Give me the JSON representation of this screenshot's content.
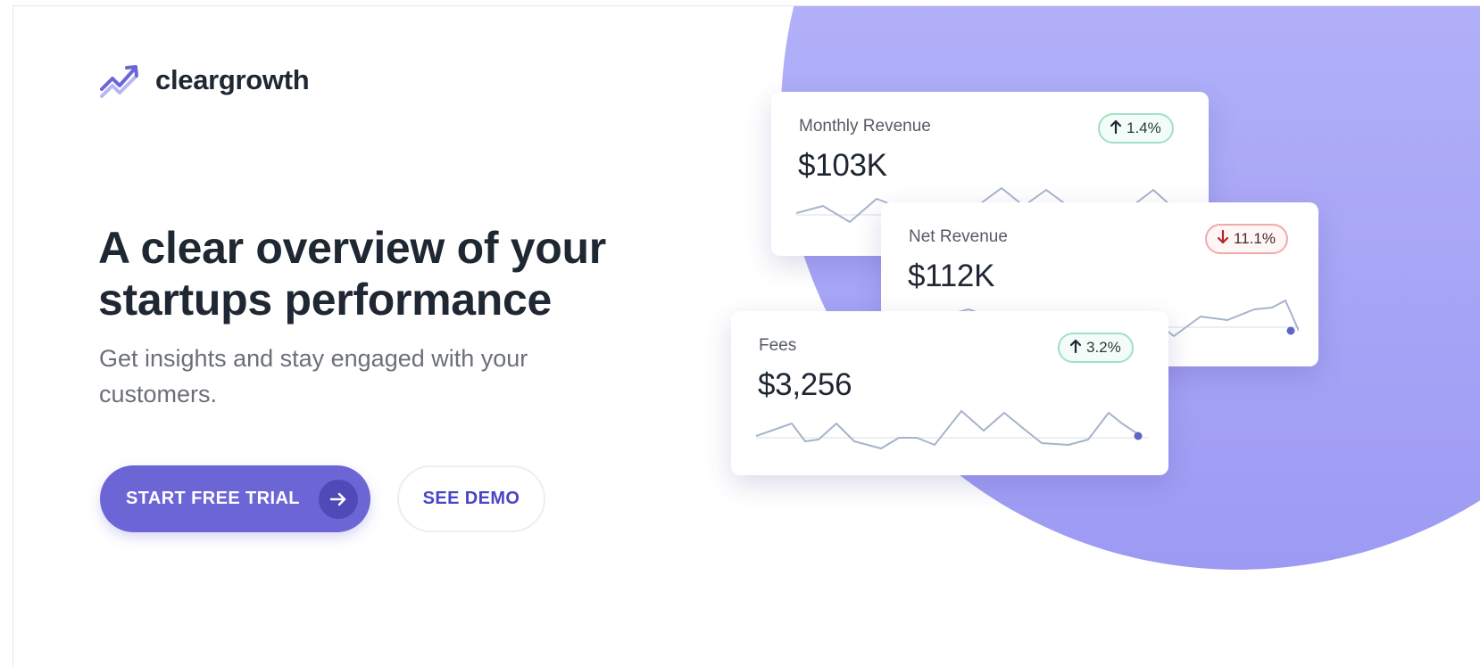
{
  "brand": {
    "name": "cleargrowth",
    "logo_icon": "trend-arrows-icon",
    "color": "#6c65d6"
  },
  "hero": {
    "headline_line1": "A clear overview of your",
    "headline_line2": "startups performance",
    "subtext_line1": "Get insights and stay engaged with your",
    "subtext_line2": "customers."
  },
  "actions": {
    "primary_label": "START FREE TRIAL",
    "primary_icon": "arrow-right-icon",
    "secondary_label": "SEE DEMO"
  },
  "cards": [
    {
      "id": "monthly-revenue",
      "title": "Monthly Revenue",
      "value": "$103K",
      "change": "1.4%",
      "direction": "up",
      "status_color": "#9fe0c6"
    },
    {
      "id": "net-revenue",
      "title": "Net Revenue",
      "value": "$112K",
      "change": "11.1%",
      "direction": "down",
      "status_color": "#f1a9ac"
    },
    {
      "id": "fees",
      "title": "Fees",
      "value": "$3,256",
      "change": "3.2%",
      "direction": "up",
      "status_color": "#9fe0c6"
    }
  ]
}
